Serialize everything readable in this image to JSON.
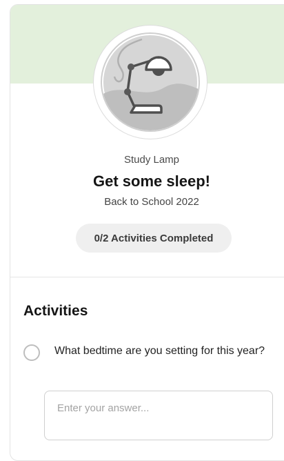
{
  "quest": {
    "badge_icon": "desk-lamp-icon",
    "category": "Study Lamp",
    "title": "Get some sleep!",
    "campaign": "Back to School 2022",
    "progress": {
      "completed": 0,
      "total": 2,
      "label": "0/2 Activities Completed"
    }
  },
  "activities": {
    "heading": "Activities",
    "items": [
      {
        "question": "What bedtime are you setting for this year?",
        "answer_placeholder": "Enter your answer...",
        "answer_value": ""
      }
    ]
  },
  "colors": {
    "banner": "#e3f0dc",
    "badge_fill": "#d2d2d2",
    "pill_bg": "#efefef"
  }
}
